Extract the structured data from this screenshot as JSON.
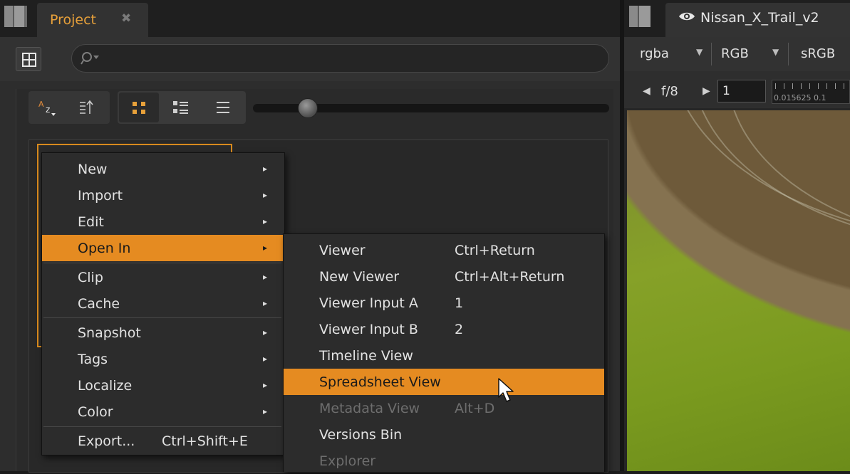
{
  "project_panel": {
    "tab_label": "Project",
    "tab_close": "✖",
    "search_placeholder": ""
  },
  "viewer": {
    "tab_label": "Nissan_X_Trail_v2",
    "channels": "rgba",
    "colorspace": "RGB",
    "lut": "sRGB",
    "fstop_label": "f/8",
    "frame_value": "1",
    "ruler_label": "0.015625  0.1"
  },
  "context_menu": {
    "items": [
      {
        "label": "New",
        "submenu": true
      },
      {
        "label": "Import",
        "submenu": true
      },
      {
        "label": "Edit",
        "submenu": true
      },
      {
        "label": "Open In",
        "submenu": true,
        "highlighted": true
      },
      {
        "label": "Clip",
        "submenu": true
      },
      {
        "label": "Cache",
        "submenu": true
      },
      {
        "label": "Snapshot",
        "submenu": true
      },
      {
        "label": "Tags",
        "submenu": true
      },
      {
        "label": "Localize",
        "submenu": true
      },
      {
        "label": "Color",
        "submenu": true
      },
      {
        "label": "Export...",
        "shortcut": "Ctrl+Shift+E"
      }
    ],
    "submenu_arrow": "▸"
  },
  "open_in_submenu": {
    "items": [
      {
        "label": "Viewer",
        "shortcut": "Ctrl+Return"
      },
      {
        "label": "New Viewer",
        "shortcut": "Ctrl+Alt+Return"
      },
      {
        "label": "Viewer Input A",
        "shortcut": "1"
      },
      {
        "label": "Viewer Input B",
        "shortcut": "2"
      },
      {
        "label": "Timeline View",
        "shortcut": ""
      },
      {
        "label": "Spreadsheet View",
        "shortcut": "",
        "highlighted": true
      },
      {
        "label": "Metadata View",
        "shortcut": "Alt+D",
        "disabled": true
      },
      {
        "label": "Versions Bin",
        "shortcut": ""
      },
      {
        "label": "Explorer",
        "shortcut": "",
        "disabled": true
      }
    ]
  },
  "colors": {
    "accent": "#e58b21",
    "tab_text": "#e8a13a",
    "menu_bg": "#2c2c2c"
  },
  "icons": {
    "layout": "layout-grid-icon",
    "search": "search-icon",
    "sort_az": "sort-alpha-icon",
    "sort_order": "sort-order-icon",
    "view_icons": "view-thumbnails-icon",
    "view_details": "view-details-icon",
    "view_list": "view-list-icon",
    "eye": "eye-icon",
    "cursor": "mouse-pointer-icon"
  }
}
